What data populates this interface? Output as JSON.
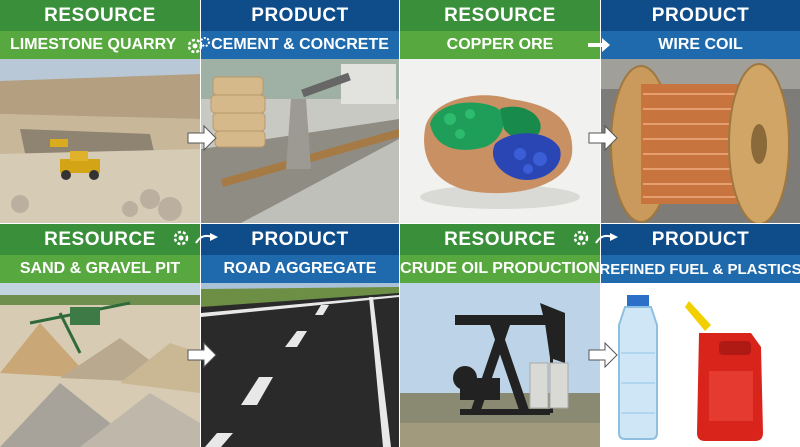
{
  "colors": {
    "resource_header": "#3a8f3a",
    "resource_sub": "#57a83f",
    "product_header": "#0f4d8a",
    "product_sub": "#1f6aad"
  },
  "panels": [
    {
      "header": "RESOURCE",
      "title": "LIMESTONE QUARRY"
    },
    {
      "header": "PRODUCT",
      "title": "CEMENT & CONCRETE"
    },
    {
      "header": "RESOURCE",
      "title": "COPPER ORE"
    },
    {
      "header": "PRODUCT",
      "title": "WIRE COIL"
    },
    {
      "header": "RESOURCE",
      "title": "SAND & GRAVEL PIT"
    },
    {
      "header": "PRODUCT",
      "title": "ROAD AGGREGATE"
    },
    {
      "header": "RESOURCE",
      "title": "CRUDE OIL PRODUCTION"
    },
    {
      "header": "PRODUCT",
      "title": "REFINED FUEL & PLASTICS"
    }
  ],
  "icons": {
    "gear": "gear-icon",
    "arrow": "arrow-right-icon"
  }
}
